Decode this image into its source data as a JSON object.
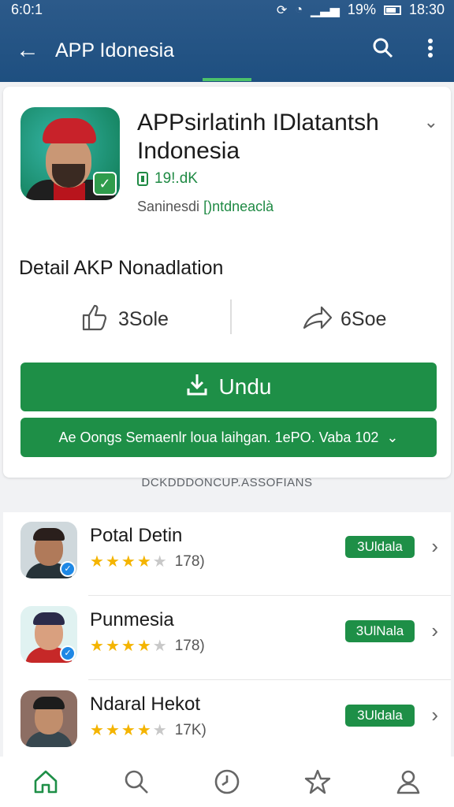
{
  "status_bar": {
    "time_left": "6:0:1",
    "battery": "19%",
    "time_right": "18:30"
  },
  "app_bar": {
    "title": "APP Idonesia",
    "icons": [
      "back-arrow-icon",
      "search-icon",
      "more-vert-icon"
    ]
  },
  "app": {
    "name": "APPsirlatinh IDlatantsh Indonesia",
    "size": "19!.dK",
    "developer_prefix": "Saninesdi",
    "developer_link": "[)ntdneaclà",
    "detail_title": "Detail AKP Nonadlation",
    "likes": "3Sole",
    "shares": "6Soe",
    "download_label": "Undu",
    "secondary_label": "Ae Oongs Semaenlr loua laihgan.  1ePO. Vaba 102"
  },
  "section_label": "DCKDDDONCUP.ASSOFIANS",
  "list": [
    {
      "name": "Potal Detin",
      "rating": 4.5,
      "count": "178)",
      "tag": "3Uldala"
    },
    {
      "name": "Punmesia",
      "rating": 4.5,
      "count": "178)",
      "tag": "3UlNala"
    },
    {
      "name": "Ndaral Hekot",
      "rating": 4.5,
      "count": "17K)",
      "tag": "3Uldala"
    }
  ],
  "bottom_nav": [
    "home-icon",
    "search-icon",
    "clock-icon",
    "star-icon",
    "profile-icon"
  ],
  "colors": {
    "app_bar": "#1e4f80",
    "accent_green": "#1e8f47",
    "star": "#f4b400"
  }
}
